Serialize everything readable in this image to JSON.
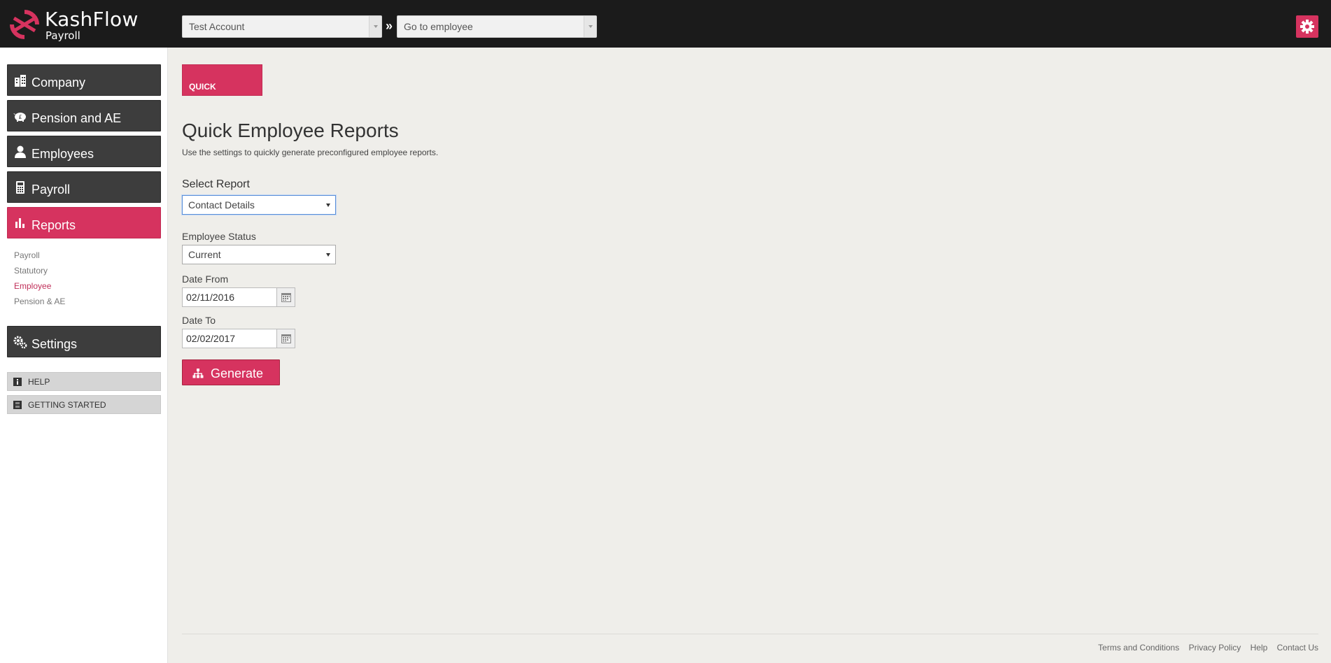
{
  "brand": {
    "name": "KashFlow",
    "product": "Payroll"
  },
  "header": {
    "account_select": "Test Account",
    "separator": "»",
    "employee_select": "Go to employee"
  },
  "sidebar": {
    "nav": [
      {
        "label": "Company",
        "icon": "building-icon",
        "active": false
      },
      {
        "label": "Pension and AE",
        "icon": "piggy-bank-icon",
        "active": false
      },
      {
        "label": "Employees",
        "icon": "user-icon",
        "active": false
      },
      {
        "label": "Payroll",
        "icon": "calculator-icon",
        "active": false
      },
      {
        "label": "Reports",
        "icon": "bar-chart-icon",
        "active": true
      }
    ],
    "reports_sub": [
      {
        "label": "Payroll",
        "active": false
      },
      {
        "label": "Statutory",
        "active": false
      },
      {
        "label": "Employee",
        "active": true
      },
      {
        "label": "Pension & AE",
        "active": false
      }
    ],
    "settings_label": "Settings",
    "help_label": "HELP",
    "getting_started_label": "GETTING STARTED"
  },
  "main": {
    "tab_label": "QUICK",
    "title": "Quick Employee Reports",
    "description": "Use the settings to quickly generate preconfigured employee reports.",
    "select_report_label": "Select Report",
    "select_report_value": "Contact Details",
    "employee_status_label": "Employee Status",
    "employee_status_value": "Current",
    "date_from_label": "Date From",
    "date_from_value": "02/11/2016",
    "date_to_label": "Date To",
    "date_to_value": "02/02/2017",
    "generate_label": "Generate"
  },
  "footer": {
    "links": [
      "Terms and Conditions",
      "Privacy Policy",
      "Help",
      "Contact Us"
    ]
  },
  "colors": {
    "accent": "#d6335f",
    "topbar": "#1b1b1b",
    "nav_dark": "#3d3d3d",
    "background": "#efeeea"
  }
}
